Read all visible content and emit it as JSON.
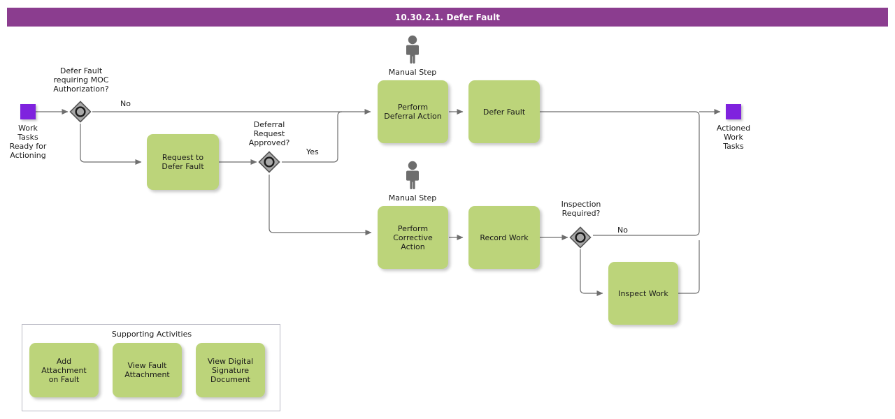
{
  "header": {
    "title": "10.30.2.1. Defer Fault",
    "bar_color": "#8B3D8F",
    "text_color": "#FFFFFF"
  },
  "theme": {
    "task_fill": "#BCD47A",
    "event_fill": "#7F22DE",
    "gateway_fill": "#A8A8A8",
    "connector": "#6E6E6E",
    "group_border": "#B9B9C4"
  },
  "events": [
    {
      "id": "start",
      "name": "start-event",
      "label": "Work\nTasks\nReady for\nActioning"
    },
    {
      "id": "end",
      "name": "end-event",
      "label": "Actioned\nWork\nTasks"
    }
  ],
  "start_event": {
    "label_line1": "Work",
    "label_line2": "Tasks",
    "label_line3": "Ready for",
    "label_line4": "Actioning"
  },
  "end_event": {
    "label_line1": "Actioned",
    "label_line2": "Work",
    "label_line3": "Tasks"
  },
  "gateways": [
    {
      "id": "gw1",
      "label": "Defer Fault\nrequiring MOC\nAuthorization?",
      "type": "inclusive"
    },
    {
      "id": "gw2",
      "label": "Deferral\nRequest\nApproved?",
      "type": "inclusive"
    },
    {
      "id": "gw3",
      "label": "Inspection\nRequired?",
      "type": "inclusive"
    }
  ],
  "gateway_labels": {
    "gw1": "Defer Fault\nrequiring MOC\nAuthorization?",
    "gw2": "Deferral\nRequest\nApproved?",
    "gw3": "Inspection\nRequired?"
  },
  "flow_labels": {
    "gw1_no": "No",
    "gw2_yes": "Yes",
    "gw3_no": "No"
  },
  "manual_steps": [
    {
      "id": "ms1",
      "label": "Manual Step"
    },
    {
      "id": "ms2",
      "label": "Manual Step"
    }
  ],
  "manual_step_labels": {
    "ms1": "Manual Step",
    "ms2": "Manual Step"
  },
  "tasks": {
    "request_to_defer_fault": "Request to\nDefer Fault",
    "perform_deferral_action": "Perform\nDeferral Action",
    "defer_fault": "Defer Fault",
    "perform_corrective_action": "Perform\nCorrective\nAction",
    "record_work": "Record Work",
    "inspect_work": "Inspect Work"
  },
  "supporting_activities": {
    "title": "Supporting Activities",
    "items": [
      {
        "id": "add-attachment-on-fault",
        "label": "Add Attachment\non Fault"
      },
      {
        "id": "view-fault-attachment",
        "label": "View Fault\nAttachment"
      },
      {
        "id": "view-digital-signature-document",
        "label": "View Digital\nSignature\nDocument"
      }
    ]
  }
}
